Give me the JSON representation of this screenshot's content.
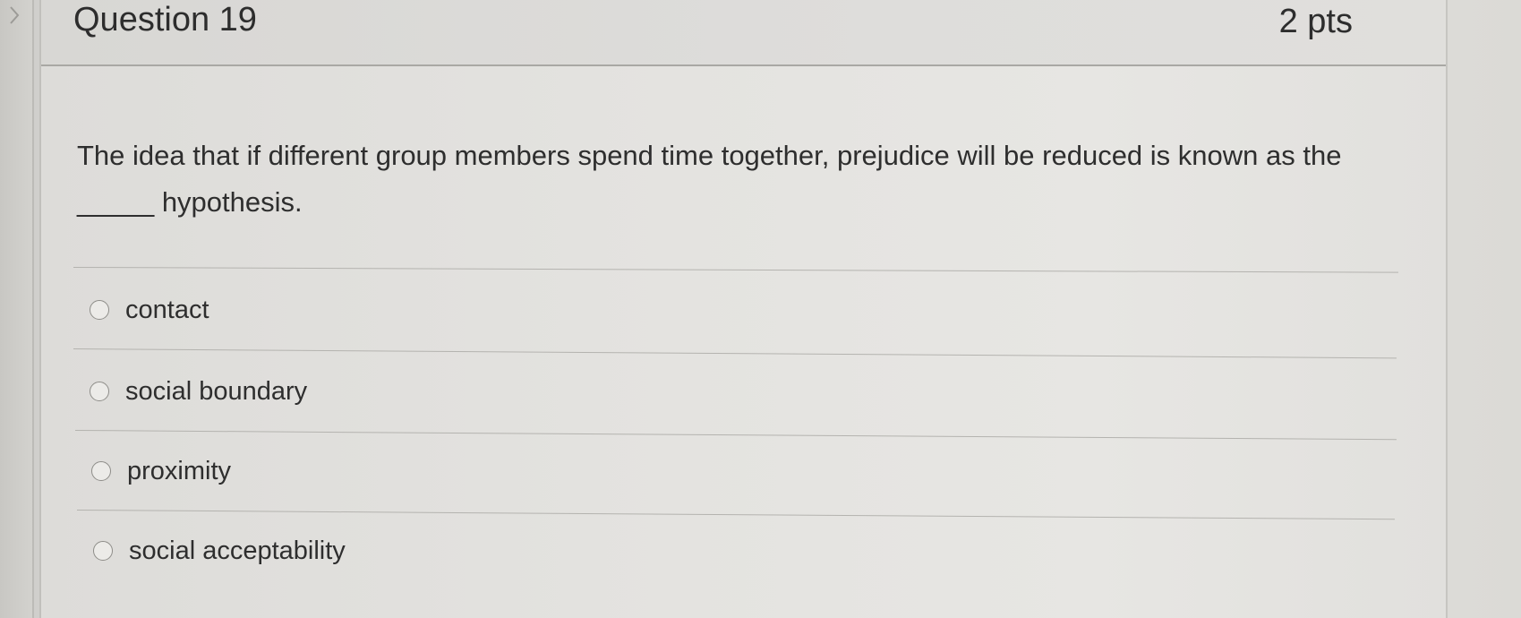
{
  "question": {
    "title": "Question 19",
    "points": "2 pts",
    "text": "The idea that if different group members spend time together, prejudice will be reduced is known as the _____ hypothesis."
  },
  "answers": [
    {
      "label": "contact",
      "selected": false
    },
    {
      "label": "social boundary",
      "selected": false
    },
    {
      "label": "proximity",
      "selected": false
    },
    {
      "label": "social acceptability",
      "selected": false
    }
  ],
  "icons": {
    "sidebar_toggle": "chevron-right-icon",
    "option_marker": "radio-button-icon"
  }
}
